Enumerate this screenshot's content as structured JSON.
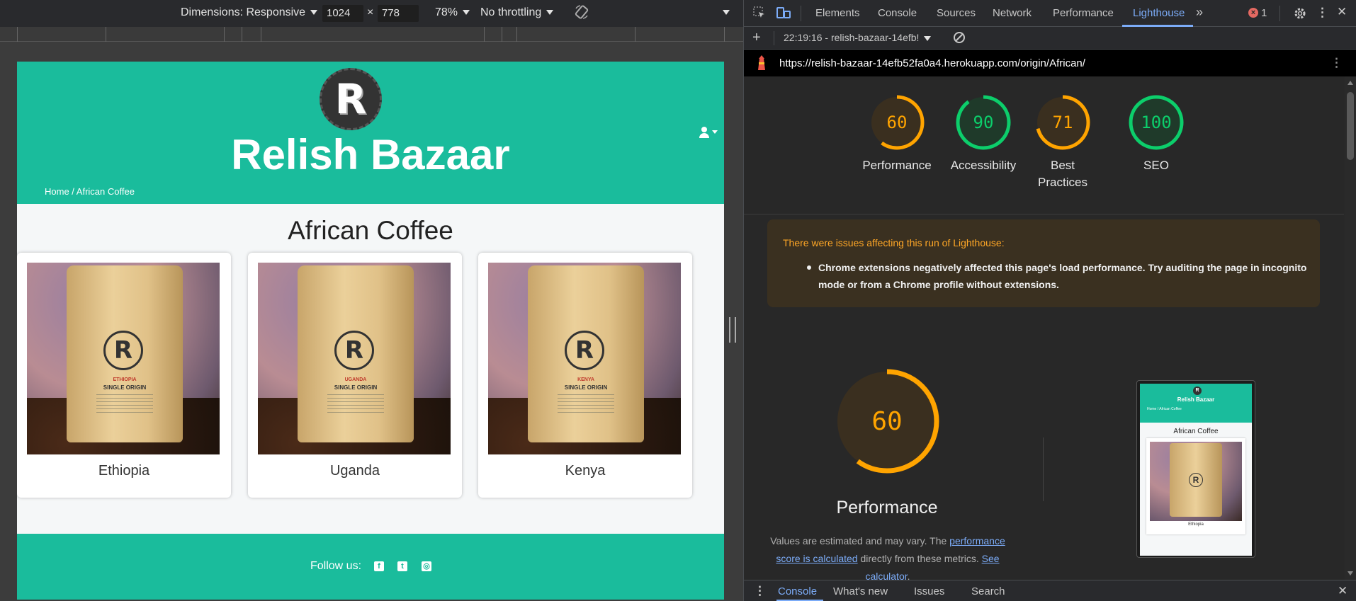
{
  "device_toolbar": {
    "dimensions_label": "Dimensions: Responsive",
    "width": "1024",
    "times": "×",
    "height": "778",
    "zoom": "78%",
    "throttling": "No throttling"
  },
  "site": {
    "logo_letter": "R",
    "title": "Relish Bazaar",
    "breadcrumb": "Home / African Coffee",
    "heading": "African Coffee",
    "products": [
      {
        "name": "Ethiopia",
        "bag_region": "ETHIOPIA",
        "bag_type": "SINGLE ORIGIN"
      },
      {
        "name": "Uganda",
        "bag_region": "UGANDA",
        "bag_type": "SINGLE ORIGIN"
      },
      {
        "name": "Kenya",
        "bag_region": "KENYA",
        "bag_type": "SINGLE ORIGIN"
      }
    ],
    "footer": {
      "follow": "Follow us:",
      "social_icons": [
        "facebook-icon",
        "twitter-icon",
        "instagram-icon"
      ]
    }
  },
  "devtools": {
    "tabs": [
      "Elements",
      "Console",
      "Sources",
      "Network",
      "Performance",
      "Lighthouse"
    ],
    "active_tab": "Lighthouse",
    "more_tabs": "»",
    "error_count": "1",
    "report_selector": "22:19:16 - relish-bazaar-14efb!",
    "url": "https://relish-bazaar-14efb52fa0a4.herokuapp.com/origin/African/",
    "scores": [
      {
        "label": "Performance",
        "value": 60,
        "color": "#ffa400"
      },
      {
        "label": "Accessibility",
        "value": 90,
        "color": "#0cce6b"
      },
      {
        "label": "Best Practices",
        "value": 71,
        "color": "#ffa400"
      },
      {
        "label": "SEO",
        "value": 100,
        "color": "#0cce6b"
      }
    ],
    "warning": {
      "title": "There were issues affecting this run of Lighthouse:",
      "item": "Chrome extensions negatively affected this page's load performance. Try auditing the page in incognito mode or from a Chrome profile without extensions."
    },
    "performance": {
      "score": 60,
      "title": "Performance",
      "desc_pre": "Values are estimated and may vary. The ",
      "desc_link1": "performance score is calculated",
      "desc_mid": " directly from these metrics. ",
      "desc_link2": "See calculator",
      "desc_post": "."
    },
    "thumbnail": {
      "logo_letter": "R",
      "title": "Relish Bazaar",
      "breadcrumb": "Home / African Coffee",
      "heading": "African Coffee",
      "product": "Ethiopia"
    },
    "drawer_tabs": [
      "Console",
      "What's new",
      "Issues",
      "Search"
    ],
    "drawer_active": "Console"
  }
}
